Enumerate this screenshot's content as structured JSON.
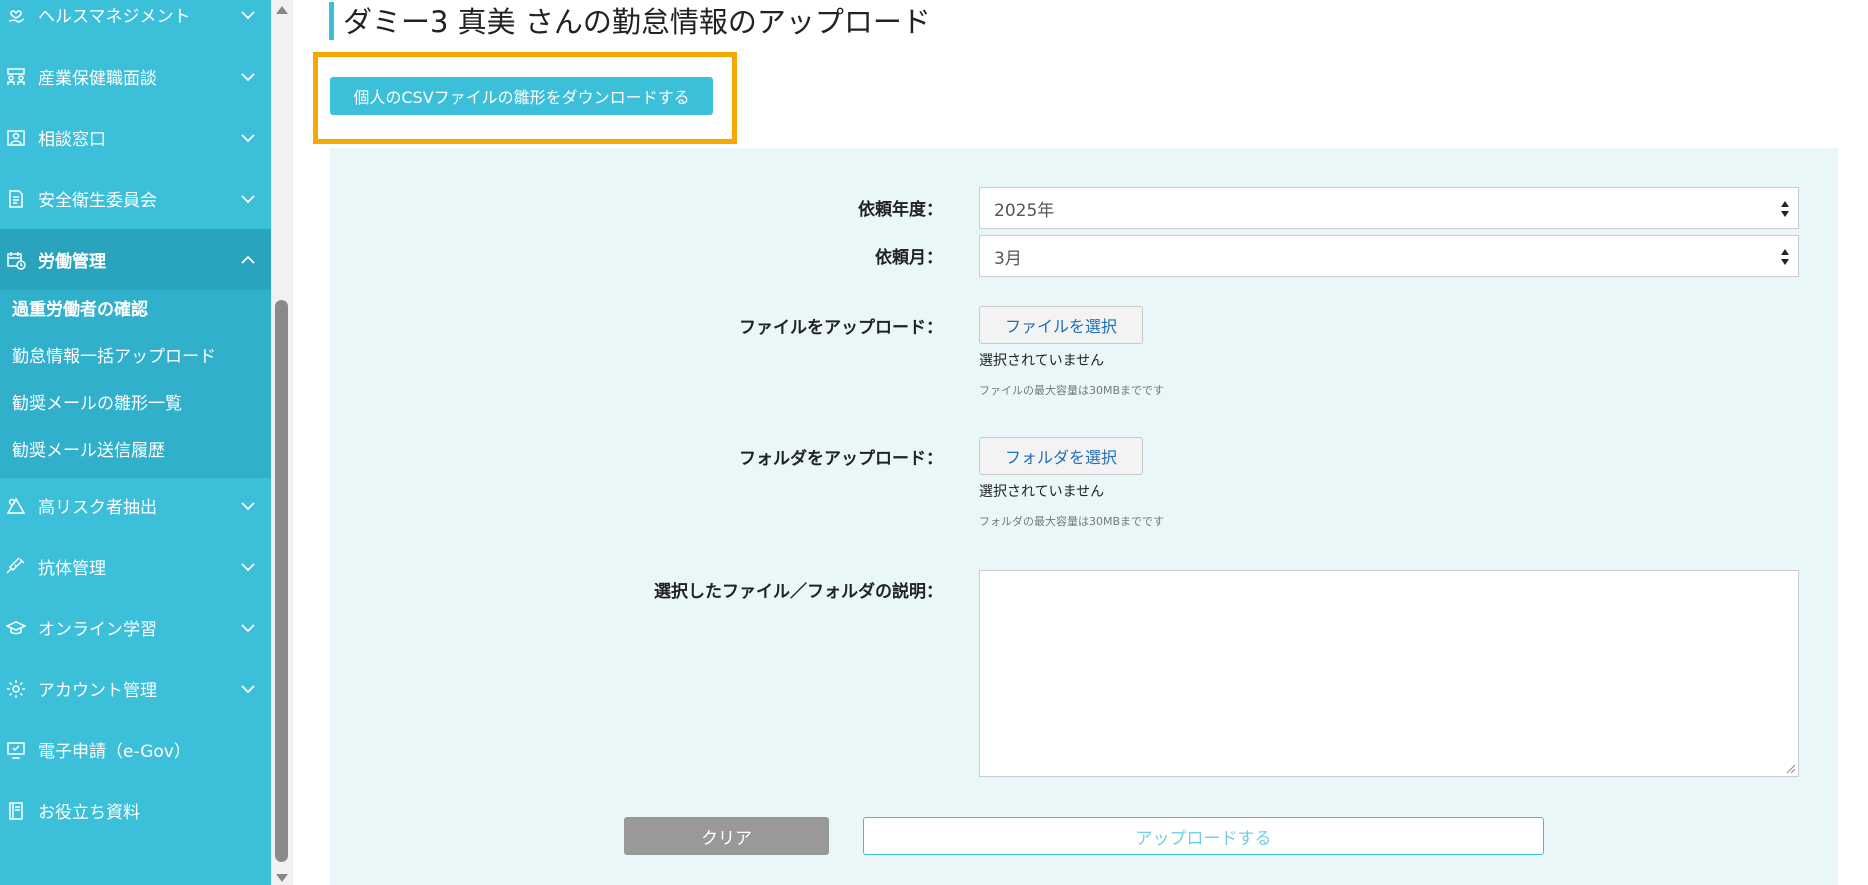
{
  "theme": {
    "accent": "#3cbfd9",
    "highlight": "#f5a800",
    "panel": "#eaf7f9"
  },
  "sidebar": {
    "items": [
      {
        "label": "ヘルスマネジメント",
        "icon": "heart-hand-icon"
      },
      {
        "label": "産業保健職面談",
        "icon": "meeting-icon"
      },
      {
        "label": "相談窓口",
        "icon": "person-card-icon"
      },
      {
        "label": "安全衛生委員会",
        "icon": "document-icon"
      },
      {
        "label": "労働管理",
        "icon": "calendar-clock-icon"
      },
      {
        "label": "高リスク者抽出",
        "icon": "risk-icon"
      },
      {
        "label": "抗体管理",
        "icon": "syringe-icon"
      },
      {
        "label": "オンライン学習",
        "icon": "graduation-cap-icon"
      },
      {
        "label": "アカウント管理",
        "icon": "gear-icon"
      },
      {
        "label": "電子申請（e-Gov）",
        "icon": "monitor-check-icon"
      },
      {
        "label": "お役立ち資料",
        "icon": "book-icon"
      }
    ],
    "submenu": [
      {
        "label": "過重労働者の確認"
      },
      {
        "label": "勤怠情報一括アップロード"
      },
      {
        "label": "勧奨メールの雛形一覧"
      },
      {
        "label": "勧奨メール送信履歴"
      }
    ]
  },
  "main": {
    "title": "ダミー3 真美 さんの勤怠情報のアップロード",
    "csv_button": "個人のCSVファイルの雛形をダウンロードする",
    "form": {
      "year_label": "依頼年度：",
      "year_value": "2025年",
      "month_label": "依頼月：",
      "month_value": "3月",
      "file_label": "ファイルをアップロード：",
      "file_button": "ファイルを選択",
      "file_status": "選択されていません",
      "file_note": "ファイルの最大容量は30MBまでです",
      "folder_label": "フォルダをアップロード：",
      "folder_button": "フォルダを選択",
      "folder_status": "選択されていません",
      "folder_note": "フォルダの最大容量は30MBまでです",
      "desc_label": "選択したファイル／フォルダの説明：",
      "desc_value": ""
    },
    "clear_button": "クリア",
    "upload_button": "アップロードする"
  }
}
